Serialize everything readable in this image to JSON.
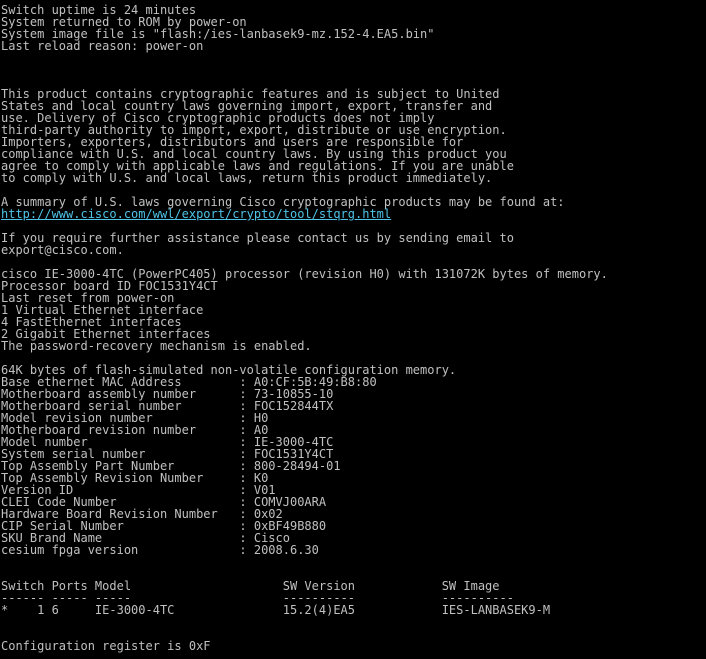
{
  "terminal": {
    "colors": {
      "background": "#000000",
      "foreground": "#c0c0c0",
      "link": "#4fc3e8"
    },
    "boot": [
      "Switch uptime is 24 minutes",
      "System returned to ROM by power-on",
      "System image file is \"flash:/ies-lanbasek9-mz.152-4.EA5.bin\"",
      "Last reload reason: power-on"
    ],
    "crypto_notice": [
      "This product contains cryptographic features and is subject to United",
      "States and local country laws governing import, export, transfer and",
      "use. Delivery of Cisco cryptographic products does not imply",
      "third-party authority to import, export, distribute or use encryption.",
      "Importers, exporters, distributors and users are responsible for",
      "compliance with U.S. and local country laws. By using this product you",
      "agree to comply with applicable laws and regulations. If you are unable",
      "to comply with U.S. and local laws, return this product immediately."
    ],
    "summary_line": "A summary of U.S. laws governing Cisco cryptographic products may be found at:",
    "summary_url": "http://www.cisco.com/wwl/export/crypto/tool/stqrg.html",
    "assistance": [
      "If you require further assistance please contact us by sending email to",
      "export@cisco.com."
    ],
    "hardware": [
      "cisco IE-3000-4TC (PowerPC405) processor (revision H0) with 131072K bytes of memory.",
      "Processor board ID FOC1531Y4CT",
      "Last reset from power-on",
      "1 Virtual Ethernet interface",
      "4 FastEthernet interfaces",
      "2 Gigabit Ethernet interfaces",
      "The password-recovery mechanism is enabled."
    ],
    "memory_line": "64K bytes of flash-simulated non-volatile configuration memory.",
    "details": [
      "Base ethernet MAC Address        : A0:CF:5B:49:B8:80",
      "Motherboard assembly number      : 73-10855-10",
      "Motherboard serial number        : FOC152844TX",
      "Model revision number            : H0",
      "Motherboard revision number      : A0",
      "Model number                     : IE-3000-4TC",
      "System serial number             : FOC1531Y4CT",
      "Top Assembly Part Number         : 800-28494-01",
      "Top Assembly Revision Number     : K0",
      "Version ID                       : V01",
      "CLEI Code Number                 : COMVJ00ARA",
      "Hardware Board Revision Number   : 0x02",
      "CIP Serial Number                : 0xBF49B880",
      "SKU Brand Name                   : Cisco",
      "cesium fpga version              : 2008.6.30"
    ],
    "switch_table": {
      "header": "Switch Ports Model                     SW Version            SW Image",
      "underline": "------ ----- -----                     ----------            ----------",
      "row": "*    1 6     IE-3000-4TC               15.2(4)EA5            IES-LANBASEK9-M"
    },
    "config_register": "Configuration register is 0xF"
  }
}
